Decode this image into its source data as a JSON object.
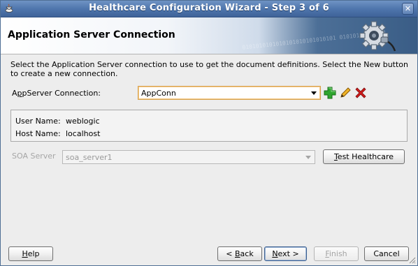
{
  "window": {
    "title": "Healthcare Configuration Wizard - Step 3 of 6",
    "close_glyph": "✕"
  },
  "header": {
    "page_title": "Application Server Connection",
    "binary_text": "0101010101010101010101010101 01010101010101"
  },
  "main": {
    "instructions": "Select the Application Server connection to use to get the document definitions.  Select the New button to create a new connection.",
    "appserver_connection": {
      "label_prefix": "A",
      "label_mnemonic": "p",
      "label_rest": "pServer Connection:",
      "value": "AppConn",
      "actions": {
        "add_icon": "plus-icon",
        "edit_icon": "pencil-icon",
        "delete_icon": "x-icon"
      }
    },
    "details": {
      "user_name_label": "User Name:",
      "user_name_value": "weblogic",
      "host_name_label": "Host Name:",
      "host_name_value": "localhost"
    },
    "soa_server": {
      "label": "SOA Server",
      "value": "soa_server1"
    },
    "test_button": {
      "mnemonic": "T",
      "rest": "est Healthcare"
    }
  },
  "footer": {
    "help": {
      "mnemonic": "H",
      "rest": "elp"
    },
    "back": {
      "prefix": "< ",
      "mnemonic": "B",
      "rest": "ack"
    },
    "next": {
      "mnemonic": "N",
      "rest": "ext >"
    },
    "finish": {
      "mnemonic": "F",
      "rest": "inish"
    },
    "cancel": "Cancel"
  },
  "colors": {
    "titlebar": "#4f76ad",
    "add_icon": "#2fa52f",
    "delete_icon": "#d11b1b",
    "edit_icon": "#e3a21a"
  }
}
